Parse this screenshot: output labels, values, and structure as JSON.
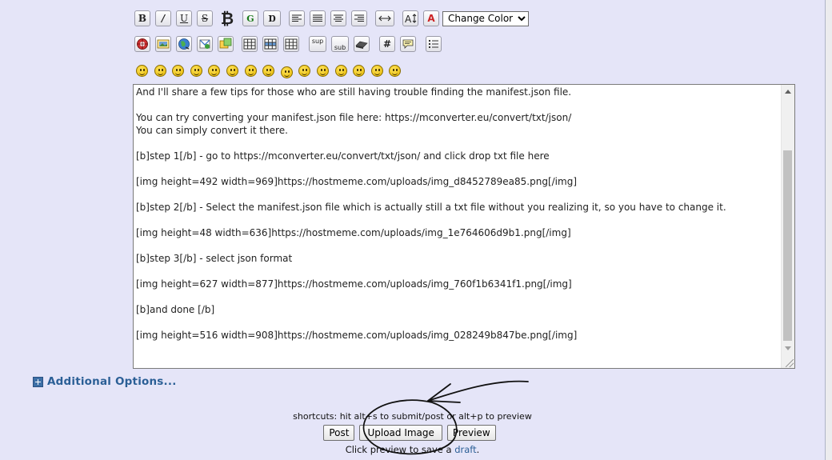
{
  "toolbar": {
    "bold_label": "B",
    "italic_label": "/",
    "underline_label": "U",
    "strike_label": "S",
    "bitcoin_label": "₿",
    "g_label": "G",
    "d_label": "Ɒ",
    "text_color_label": "A",
    "change_color_select": "Change Color",
    "sup_label": "sup",
    "sub_label": "sub",
    "hash_label": "#"
  },
  "editor": {
    "content": "And I'll share a few tips for those who are still having trouble finding the manifest.json file.\n\nYou can try converting your manifest.json file here: https://mconverter.eu/convert/txt/json/\nYou can simply convert it there.\n\n[b]step 1[/b] - go to https://mconverter.eu/convert/txt/json/ and click drop txt file here\n\n[img height=492 width=969]https://hostmeme.com/uploads/img_d8452789ea85.png[/img]\n\n[b]step 2[/b] - Select the manifest.json file which is actually still a txt file without you realizing it, so you have to change it.\n\n[img height=48 width=636]https://hostmeme.com/uploads/img_1e764606d9b1.png[/img]\n\n[b]step 3[/b] - select json format\n\n[img height=627 width=877]https://hostmeme.com/uploads/img_760f1b6341f1.png[/img]\n\n[b]and done [/b]\n\n[img height=516 width=908]https://hostmeme.com/uploads/img_028249b847be.png[/img]"
  },
  "additional_options": "Additional Options...",
  "shortcuts_text": "shortcuts: hit alt+s to submit/post or alt+p to preview",
  "buttons": {
    "post": "Post",
    "upload_image": "Upload Image",
    "preview": "Preview"
  },
  "draft_line": {
    "prefix": "Click preview to save a ",
    "link": "draft",
    "suffix": "."
  },
  "colors": {
    "background": "#e5e5f8",
    "link": "#2b5f96",
    "annotation_ink": "#111111"
  },
  "smileys_count": 15
}
